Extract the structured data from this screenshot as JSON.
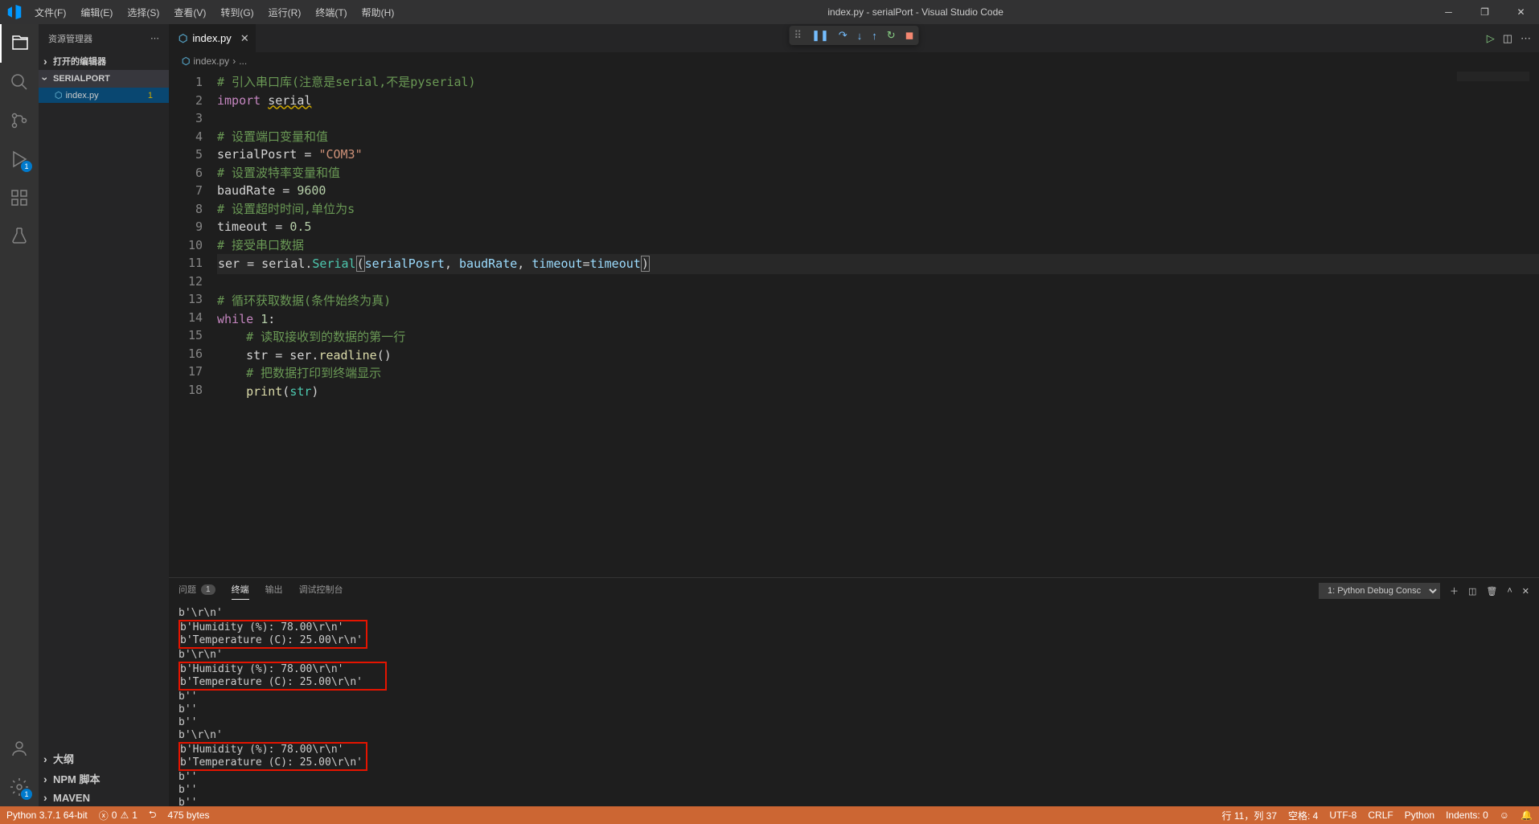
{
  "title": "index.py - serialPort - Visual Studio Code",
  "menus": [
    "文件(F)",
    "编辑(E)",
    "选择(S)",
    "查看(V)",
    "转到(G)",
    "运行(R)",
    "终端(T)",
    "帮助(H)"
  ],
  "sidebar": {
    "title": "资源管理器",
    "editors_section": "打开的编辑器",
    "project_section": "SERIALPORT",
    "file": "index.py",
    "file_badge": "1",
    "outline": "大纲",
    "npm": "NPM 脚本",
    "maven": "MAVEN"
  },
  "tab": {
    "name": "index.py"
  },
  "breadcrumb": [
    "index.py",
    "..."
  ],
  "debug_badge": "1",
  "settings_badge": "1",
  "code": {
    "lines": [
      {
        "n": 1,
        "html": "<span class='c-comment'># 引入串口库(注意是serial,不是pyserial)</span>"
      },
      {
        "n": 2,
        "html": "<span class='c-keyword'>import</span> <span class='squiggle'>serial</span>"
      },
      {
        "n": 3,
        "html": ""
      },
      {
        "n": 4,
        "html": "<span class='c-comment'># 设置端口变量和值</span>"
      },
      {
        "n": 5,
        "html": "serialPosrt = <span class='c-string'>\"COM3\"</span>"
      },
      {
        "n": 6,
        "html": "<span class='c-comment'># 设置波特率变量和值</span>"
      },
      {
        "n": 7,
        "html": "baudRate = <span class='c-number'>9600</span>"
      },
      {
        "n": 8,
        "html": "<span class='c-comment'># 设置超时时间,单位为s</span>"
      },
      {
        "n": 9,
        "html": "timeout = <span class='c-number'>0.5</span>"
      },
      {
        "n": 10,
        "html": "<span class='c-comment'># 接受串口数据</span>"
      },
      {
        "n": 11,
        "active": true,
        "html": "ser = serial.<span class='c-class'>Serial</span><span class='bracket-hl'>(</span><span class='c-var'>serialPosrt</span>, <span class='c-var'>baudRate</span>, <span class='c-var'>timeout</span>=<span class='c-var'>timeout</span><span class='bracket-hl'>)</span>"
      },
      {
        "n": 12,
        "html": ""
      },
      {
        "n": 13,
        "html": "<span class='c-comment'># 循环获取数据(条件始终为真)</span>"
      },
      {
        "n": 14,
        "html": "<span class='c-keyword'>while</span> <span class='c-number'>1</span>:"
      },
      {
        "n": 15,
        "html": "    <span class='c-comment'># 读取接收到的数据的第一行</span>"
      },
      {
        "n": 16,
        "html": "    str = ser.<span class='c-function'>readline</span>()"
      },
      {
        "n": 17,
        "html": "    <span class='c-comment'># 把数据打印到终端显示</span>"
      },
      {
        "n": 18,
        "html": "    <span class='c-function'>print</span>(<span class='c-class'>str</span>)"
      }
    ]
  },
  "panel": {
    "tabs": {
      "problems": "问题",
      "problems_badge": "1",
      "terminal": "终端",
      "output": "输出",
      "debug": "调试控制台"
    },
    "dropdown": "1: Python Debug Consc",
    "lines": [
      {
        "t": "b'\\r\\n'"
      },
      {
        "box": true,
        "t": "b'Humidity (%): 78.00\\r\\n'\nb'Temperature (C): 25.00\\r\\n'"
      },
      {
        "t": "b'\\r\\n'"
      },
      {
        "box": true,
        "wide": true,
        "t": "b'Humidity (%): 78.00\\r\\n'\nb'Temperature (C): 25.00\\r\\n'"
      },
      {
        "t": "b''"
      },
      {
        "t": "b''"
      },
      {
        "t": "b''"
      },
      {
        "t": "b'\\r\\n'"
      },
      {
        "box": true,
        "t": "b'Humidity (%): 78.00\\r\\n'\nb'Temperature (C): 25.00\\r\\n'"
      },
      {
        "t": "b''"
      },
      {
        "t": "b''"
      },
      {
        "t": "b''"
      },
      {
        "t": "▮"
      }
    ]
  },
  "status": {
    "python": "Python 3.7.1 64-bit",
    "errors": "0",
    "warnings": "1",
    "size": "475 bytes",
    "pos": "行 11，列 37",
    "spaces": "空格: 4",
    "encoding": "UTF-8",
    "eol": "CRLF",
    "lang": "Python",
    "indents": "Indents: 0"
  }
}
